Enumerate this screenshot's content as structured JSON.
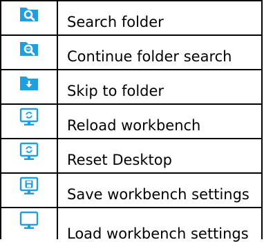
{
  "colors": {
    "accent": "#1f9fdf",
    "border": "#000000"
  },
  "menu": {
    "items": [
      {
        "icon": "search-folder-icon",
        "label": "Search folder"
      },
      {
        "icon": "continue-folder-search-icon",
        "label": "Continue folder search"
      },
      {
        "icon": "skip-to-folder-icon",
        "label": "Skip to folder"
      },
      {
        "icon": "reload-workbench-icon",
        "label": "Reload workbench"
      },
      {
        "icon": "reset-desktop-icon",
        "label": "Reset Desktop"
      },
      {
        "icon": "save-workbench-settings-icon",
        "label": "Save workbench settings"
      },
      {
        "icon": "load-workbench-settings-icon",
        "label": "Load workbench settings"
      }
    ]
  }
}
